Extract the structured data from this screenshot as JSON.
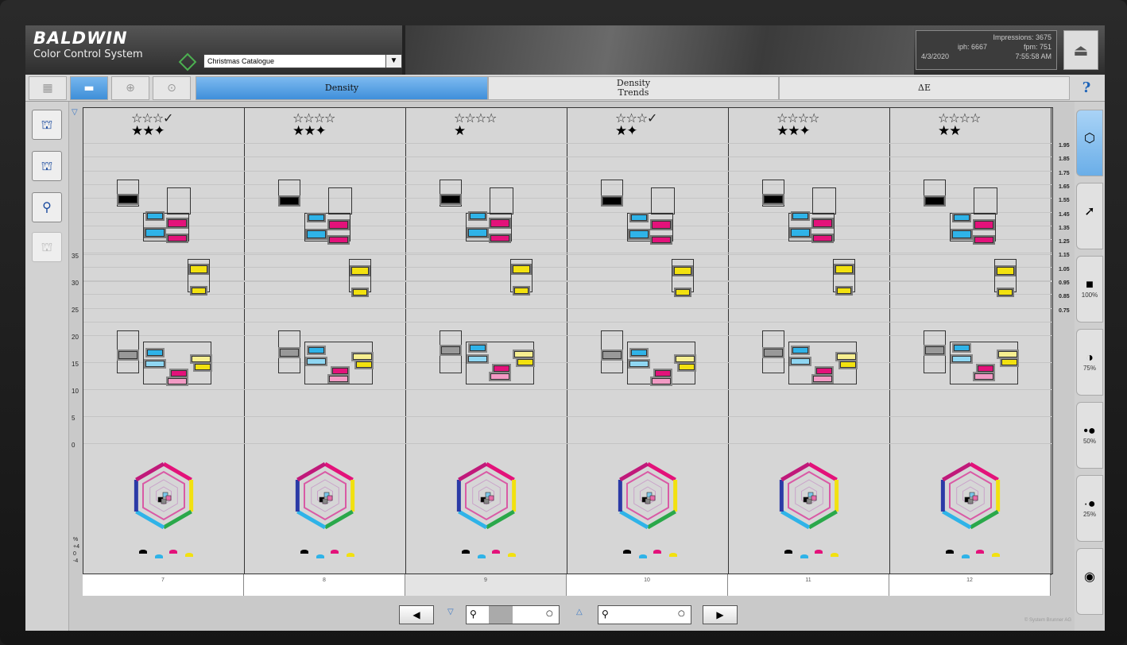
{
  "app": {
    "brand": "BALDWIN",
    "subtitle": "Color Control System",
    "job_name": "Christmas Catalogue"
  },
  "stats": {
    "impressions": "Impressions: 3675",
    "iph": "iph: 6667",
    "fpm": "fpm: 751",
    "date": "4/3/2020",
    "time": "7:55:58 AM"
  },
  "tabs": [
    {
      "label": "Density",
      "active": true
    },
    {
      "label": "Density\nTrends",
      "active": false
    },
    {
      "label": "ΔE",
      "active": false
    }
  ],
  "help_label": "?",
  "left_axis": [
    "35",
    "30",
    "25",
    "20",
    "15",
    "10",
    "5",
    "0"
  ],
  "left_axis_pct": [
    "%",
    "+4",
    "0",
    "-4"
  ],
  "right_axis": [
    "1.95",
    "1.85",
    "1.75",
    "1.65",
    "1.55",
    "1.45",
    "1.35",
    "1.25",
    "1.15",
    "1.05",
    "0.95",
    "0.85",
    "0.75"
  ],
  "right_tools": [
    {
      "label": "",
      "icon": "color-wheel-icon"
    },
    {
      "label": "",
      "icon": "arrow-icon"
    },
    {
      "label": "100%",
      "icon": "solid-square-icon"
    },
    {
      "label": "75%",
      "icon": "half-circle-icon"
    },
    {
      "label": "50%",
      "icon": "dot-pair-icon"
    },
    {
      "label": "25%",
      "icon": "dot-pair-small-icon"
    },
    {
      "label": "",
      "icon": "color-wheel-small-icon"
    }
  ],
  "units": [
    {
      "number": "7",
      "outline_stars": "☆☆☆✓",
      "filled_stars": "★★✦"
    },
    {
      "number": "8",
      "outline_stars": "☆☆☆☆",
      "filled_stars": "★★✦"
    },
    {
      "number": "9",
      "outline_stars": "☆☆☆☆",
      "filled_stars": "★"
    },
    {
      "number": "10",
      "outline_stars": "☆☆☆✓",
      "filled_stars": "★✦"
    },
    {
      "number": "11",
      "outline_stars": "☆☆☆☆",
      "filled_stars": "★★✦"
    },
    {
      "number": "12",
      "outline_stars": "☆☆☆☆",
      "filled_stars": "★★"
    }
  ],
  "colors": {
    "cyan": "#2fb3e8",
    "magenta": "#e3127a",
    "yellow": "#f2e10f",
    "black": "#000000",
    "accent": "#3f8fda"
  },
  "copyright": "© System Brunner AG"
}
